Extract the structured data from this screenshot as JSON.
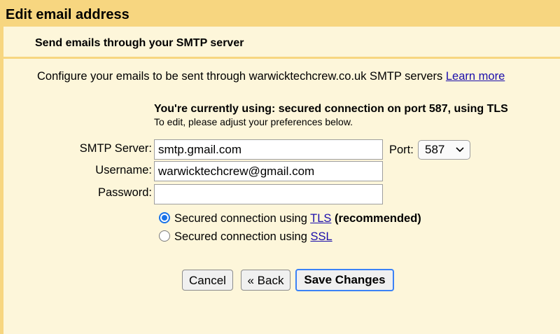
{
  "dialog": {
    "title": "Edit email address",
    "subtitle": "Send emails through your SMTP server"
  },
  "config": {
    "description": "Configure your emails to be sent through warwicktechcrew.co.uk SMTP servers",
    "learn_more": "Learn more"
  },
  "status": {
    "current": "You're currently using: secured connection on port 587, using TLS",
    "hint": "To edit, please adjust your preferences below."
  },
  "form": {
    "smtp_label": "SMTP Server:",
    "smtp_value": "smtp.gmail.com",
    "port_label": "Port:",
    "port_value": "587",
    "username_label": "Username:",
    "username_value": "warwicktechcrew@gmail.com",
    "password_label": "Password:",
    "password_value": ""
  },
  "security": {
    "tls_prefix": "Secured connection using ",
    "tls_link": "TLS",
    "tls_suffix": " (recommended)",
    "tls_selected": true,
    "ssl_prefix": "Secured connection using ",
    "ssl_link": "SSL",
    "ssl_selected": false
  },
  "buttons": {
    "cancel": "Cancel",
    "back": "« Back",
    "save": "Save Changes"
  },
  "colors": {
    "header_bg": "#f7d680",
    "panel_bg": "#fdf6da",
    "link": "#1a0dab",
    "accent": "#1a73e8"
  },
  "icons": {
    "port_dropdown": "chevron-down-icon"
  }
}
